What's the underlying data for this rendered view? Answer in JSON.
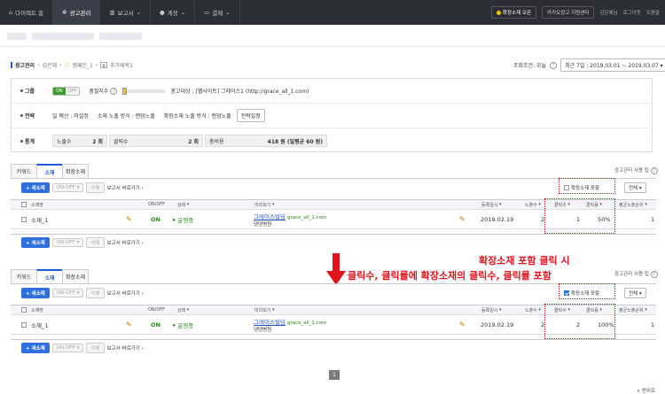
{
  "nav": {
    "items": [
      "다이렉트 홈",
      "광고관리",
      "보고서",
      "계정",
      "결제"
    ],
    "active_index": 1,
    "expand_button": "확장소재 오픈",
    "kakao_button": "카카오광고 지원센터",
    "user_name": "김은혜님",
    "logout": "로그아웃",
    "help": "도움말"
  },
  "breadcrumb": {
    "items": [
      "광고관리",
      "김은혜",
      "캠페인_1",
      "추가제목1"
    ]
  },
  "period": {
    "label": "조회조건: 오늘",
    "value": "최근 7일 : 2019.03.01 ~ 2019.03.07"
  },
  "info": {
    "group_label": "그룹",
    "toggle_on": "ON",
    "toggle_off": "OFF",
    "quality_label": "품질지수",
    "ad_target": "광고대상 : [웹사이트] 그레이스1 (http://grace_all_1.com)",
    "strategy_label": "전략",
    "daily_budget": "일 예산 : 미설정",
    "material_exposure": "소재 노출 방식 : 랜덤노출",
    "expansion_exposure": "확장소재 노출 방식 : 랜덤노출",
    "strategy_button": "전략설정",
    "stats_label": "통계",
    "stats": [
      {
        "label": "노출수",
        "value": "2 회"
      },
      {
        "label": "클릭수",
        "value": "2 회"
      },
      {
        "label": "총비용",
        "value": "418 원 (일평균 60 원)"
      }
    ]
  },
  "tabs": [
    "키워드",
    "소재",
    "확장소재"
  ],
  "active_tab": 1,
  "tips_link": "광고관리 사용 팁",
  "toolbar": {
    "new_button": "+ 새소재",
    "onoff": "ON-OFF",
    "delete": "삭제",
    "report": "보고서 바로가기"
  },
  "include_label": "확장소재 포함",
  "filter": "전체",
  "columns": [
    "소재명",
    "ON/OFF",
    "상태",
    "미리보기",
    "등록일시",
    "노출수",
    "클릭수",
    "클릭률",
    "평균노출순위"
  ],
  "table1": {
    "name": "소재_1",
    "onoff": "ON",
    "status": "운영중",
    "title": "그레이스빌딩",
    "url": "grace_all_1.com",
    "desc": "댕댕병원",
    "date": "2019.02.19",
    "impressions": "2",
    "clicks": "1",
    "ctr": "50%",
    "rank": "1"
  },
  "table2": {
    "name": "소재_1",
    "onoff": "ON",
    "status": "운영중",
    "title": "그레이스빌딩",
    "url": "grace_all_1.com",
    "desc": "댕댕병원",
    "date": "2019.02.19",
    "impressions": "2",
    "clicks": "2",
    "ctr": "100%",
    "rank": "1"
  },
  "annotation": {
    "line1": "확장소재 포함 클릭 시",
    "line2": "클릭수, 클릭률에 확장소재의 클릭수, 클릭률 포함"
  },
  "pagination": {
    "current": "1"
  },
  "top_link": "∧ 맨위로",
  "colors": {
    "nav_bg": "#2b2e34",
    "primary": "#2f6fde",
    "on_green": "#3d9a2f",
    "annotation_red": "#e0141c"
  }
}
